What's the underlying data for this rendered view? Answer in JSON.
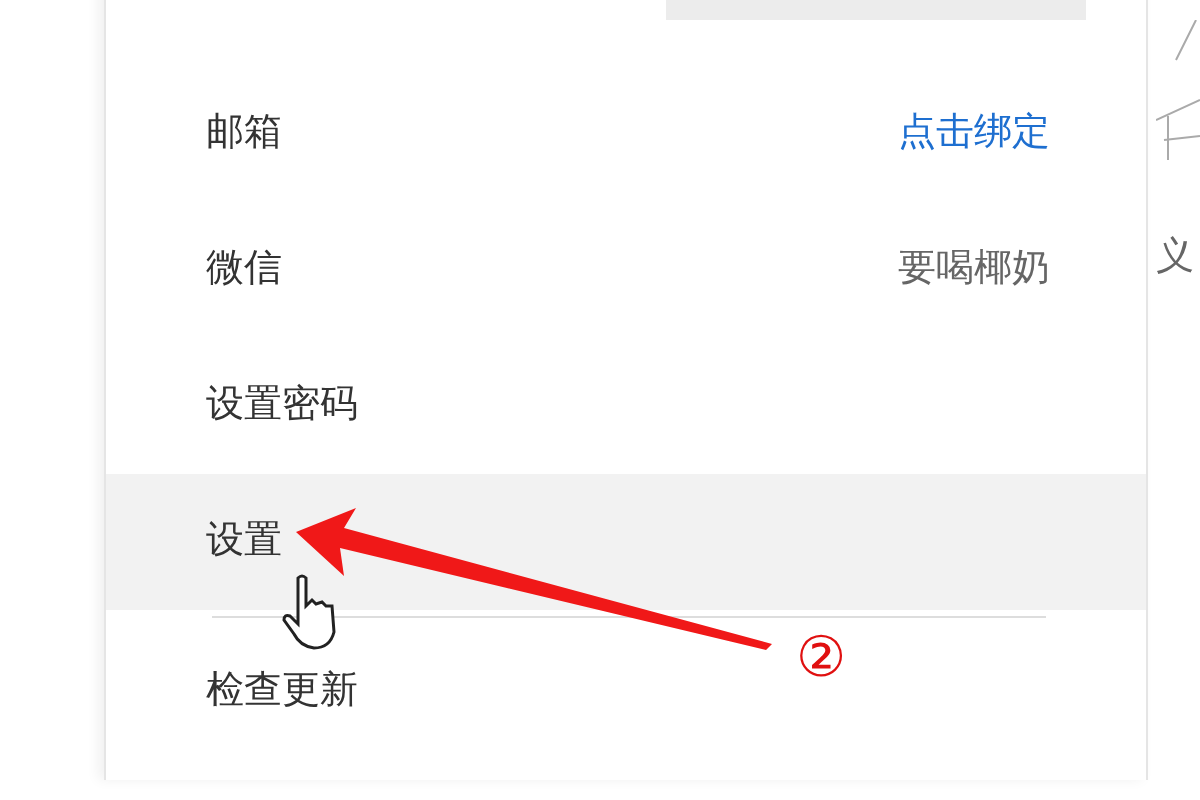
{
  "menu": {
    "items": [
      {
        "label": "邮箱",
        "value": "点击绑定",
        "kind": "link",
        "selected": false
      },
      {
        "label": "微信",
        "value": "要喝椰奶",
        "kind": "value",
        "selected": false
      },
      {
        "label": "设置密码",
        "kind": "plain",
        "selected": false
      },
      {
        "label": "设置",
        "kind": "plain",
        "selected": true
      },
      {
        "label": "检查更新",
        "kind": "plain",
        "selected": false
      }
    ]
  },
  "annotation": {
    "step": "②"
  },
  "background_text": "义"
}
